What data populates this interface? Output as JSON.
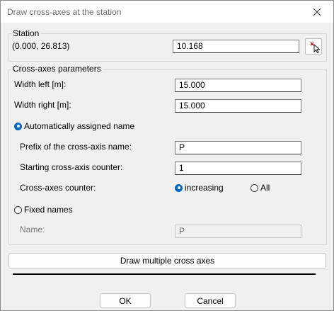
{
  "window": {
    "title": "Draw cross-axes at the station",
    "close_icon": "close-icon"
  },
  "station": {
    "legend": "Station",
    "coordinates": "(0.000, 26.813)",
    "value": "10.168",
    "pick_icon": "pick-point-icon"
  },
  "params": {
    "legend": "Cross-axes parameters",
    "width_left_label": "Width left [m]:",
    "width_left_value": "15.000",
    "width_right_label": "Width right [m]:",
    "width_right_value": "15.000",
    "auto_name_label": "Automatically assigned name",
    "auto_name_selected": true,
    "prefix_label": "Prefix of the cross-axis name:",
    "prefix_value": "P",
    "start_counter_label": "Starting cross-axis counter:",
    "start_counter_value": "1",
    "counter_label": "Cross-axes counter:",
    "counter_increasing_label": "increasing",
    "counter_all_label": "All",
    "counter_selected": "increasing",
    "fixed_names_label": "Fixed names",
    "fixed_names_selected": false,
    "name_label": "Name:",
    "name_value": "P"
  },
  "actions": {
    "draw_multiple_label": "Draw multiple cross axes",
    "ok_label": "OK",
    "cancel_label": "Cancel"
  },
  "colors": {
    "accent": "#0067c0"
  }
}
